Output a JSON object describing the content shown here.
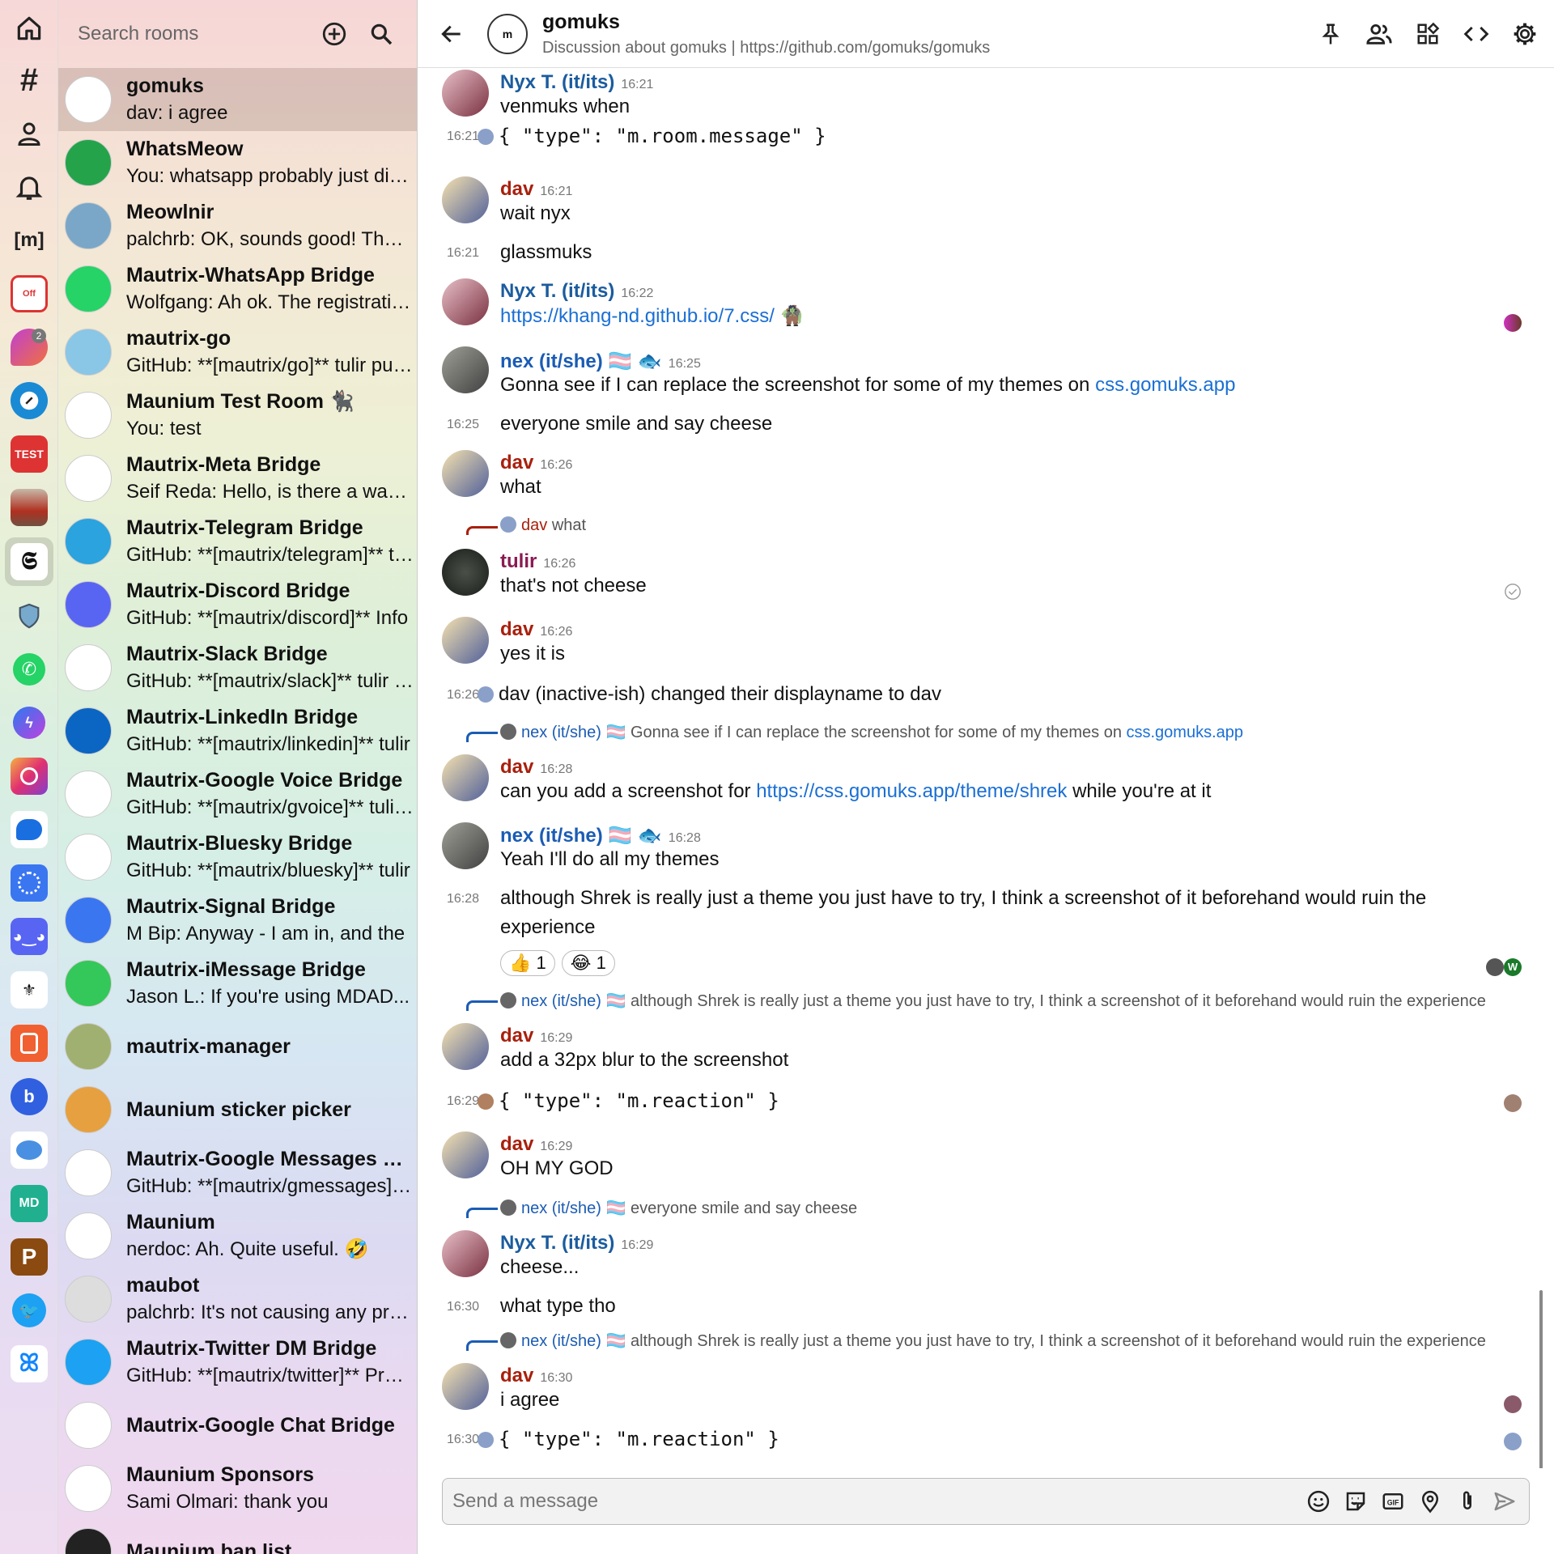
{
  "search": {
    "placeholder": "Search rooms"
  },
  "rooms": [
    {
      "name": "gomuks",
      "preview": "dav: i agree",
      "color": "#ffffff"
    },
    {
      "name": "WhatsMeow",
      "preview": "You: whatsapp probably just did a lot of manual testing",
      "color": "#25a34a"
    },
    {
      "name": "Meowlnir",
      "preview": "palchrb: OK, sounds good! Thanks for the help",
      "color": "#7aa7c7"
    },
    {
      "name": "Mautrix-WhatsApp Bridge",
      "preview": "Wolfgang: Ah ok. The registration file",
      "color": "#25d366"
    },
    {
      "name": "mautrix-go",
      "preview": "GitHub: **[mautrix/go]** tulir pushed",
      "color": "#8ac6e6"
    },
    {
      "name": "Maunium Test Room 🐈‍⬛",
      "preview": "You: test",
      "color": "#ffffff"
    },
    {
      "name": "Mautrix-Meta Bridge",
      "preview": "Seif Reda: Hello, is there a way to",
      "color": "#ffffff"
    },
    {
      "name": "Mautrix-Telegram Bridge",
      "preview": "GitHub: **[mautrix/telegram]** tulir",
      "color": "#2aa3de"
    },
    {
      "name": "Mautrix-Discord Bridge",
      "preview": "GitHub: **[mautrix/discord]** Info",
      "color": "#5865f2"
    },
    {
      "name": "Mautrix-Slack Bridge",
      "preview": "GitHub: **[mautrix/slack]** tulir pushed",
      "color": "#ffffff"
    },
    {
      "name": "Mautrix-LinkedIn Bridge",
      "preview": "GitHub: **[mautrix/linkedin]** tulir",
      "color": "#0a66c2"
    },
    {
      "name": "Mautrix-Google Voice Bridge",
      "preview": "GitHub: **[mautrix/gvoice]** tulir pushed",
      "color": "#ffffff"
    },
    {
      "name": "Mautrix-Bluesky Bridge",
      "preview": "GitHub: **[mautrix/bluesky]** tulir",
      "color": "#ffffff"
    },
    {
      "name": "Mautrix-Signal Bridge",
      "preview": "M Bip: Anyway - I am in, and the",
      "color": "#3a76f0"
    },
    {
      "name": "Mautrix-iMessage Bridge",
      "preview": "Jason L.: If you're using MDAD...",
      "color": "#34c759"
    },
    {
      "name": "mautrix-manager",
      "preview": "",
      "color": "#a0b070"
    },
    {
      "name": "Maunium sticker picker",
      "preview": "",
      "color": "#e6a040"
    },
    {
      "name": "Mautrix-Google Messages Bridge",
      "preview": "GitHub: **[mautrix/gmessages]** tulir",
      "color": "#ffffff"
    },
    {
      "name": "Maunium",
      "preview": "nerdoc: Ah. Quite useful. 🤣",
      "color": "#ffffff"
    },
    {
      "name": "maubot",
      "preview": "palchrb: It's not causing any problems",
      "color": "#dddddd"
    },
    {
      "name": "Mautrix-Twitter DM Bridge",
      "preview": "GitHub: **[mautrix/twitter]** Project",
      "color": "#1da1f2"
    },
    {
      "name": "Mautrix-Google Chat Bridge",
      "preview": "",
      "color": "#ffffff"
    },
    {
      "name": "Maunium Sponsors",
      "preview": "Sami Olmari: thank you",
      "color": "#ffffff"
    },
    {
      "name": "Maunium ban list",
      "preview": "",
      "color": "#222222"
    }
  ],
  "spaces": {
    "badge_count": "2",
    "letter_m": "[m]",
    "letter_p": "P",
    "test_label": "TEST",
    "md_label": "MD"
  },
  "header": {
    "room_name": "gomuks",
    "topic": "Discussion about gomuks | https://github.com/gomuks/gomuks"
  },
  "timeline": {
    "e1": {
      "sender": "Nyx T. (it/its)",
      "time": "16:21",
      "body": "venmuks when"
    },
    "e2": {
      "time": "16:21",
      "body": "{ \"type\": \"m.room.message\" }"
    },
    "e3": {
      "sender": "dav",
      "time": "16:21",
      "body": "wait nyx"
    },
    "e4": {
      "time": "16:21",
      "body": "glassmuks"
    },
    "e5": {
      "sender": "Nyx T. (it/its)",
      "time": "16:22",
      "link": "https://khang-nd.github.io/7.css/",
      "emoji": "🧌"
    },
    "e6": {
      "sender": "nex (it/she) 🏳️‍⚧️ 🐟",
      "time": "16:25",
      "body": "Gonna see if I can replace the screenshot for some of my themes on",
      "link": "css.gomuks.app"
    },
    "e7": {
      "time": "16:25",
      "body": "everyone smile and say cheese"
    },
    "e8": {
      "sender": "dav",
      "time": "16:26",
      "body": "what"
    },
    "r1": {
      "sender": "dav",
      "text": "what"
    },
    "e9": {
      "sender": "tulir",
      "time": "16:26",
      "body": "that's not cheese"
    },
    "e10": {
      "sender": "dav",
      "time": "16:26",
      "body": "yes it is"
    },
    "e11": {
      "time": "16:26",
      "body": "dav (inactive-ish) changed their displayname to dav"
    },
    "r2": {
      "sender": "nex (it/she) 🏳️‍⚧️",
      "text": "Gonna see if I can replace the screenshot for some of my themes on",
      "link": "css.gomuks.app"
    },
    "e12": {
      "sender": "dav",
      "time": "16:28",
      "body_a": "can you add a screenshot for",
      "link": "https://css.gomuks.app/theme/shrek",
      "body_b": "while you're at it"
    },
    "e13": {
      "sender": "nex (it/she) 🏳️‍⚧️ 🐟",
      "time": "16:28",
      "body": "Yeah I'll do all my themes"
    },
    "e14": {
      "time": "16:28",
      "body_a": "although Shrek is really just a theme you just have to try, I think a screenshot of it beforehand would ruin the",
      "body_b": "experience",
      "react1": "👍 1",
      "react2": "😂 1"
    },
    "r3": {
      "sender": "nex (it/she) 🏳️‍⚧️",
      "text": "although Shrek is really just a theme you just have to try, I think a screenshot of it beforehand would ruin the experience"
    },
    "e15": {
      "sender": "dav",
      "time": "16:29",
      "body": "add a 32px blur to the screenshot"
    },
    "e16": {
      "time": "16:29",
      "body": "{ \"type\": \"m.reaction\" }"
    },
    "e17": {
      "sender": "dav",
      "time": "16:29",
      "body": "OH MY GOD"
    },
    "r4": {
      "sender": "nex (it/she) 🏳️‍⚧️",
      "text": "everyone smile and say cheese"
    },
    "e18": {
      "sender": "Nyx T. (it/its)",
      "time": "16:29",
      "body": "cheese..."
    },
    "e19": {
      "time": "16:30",
      "body": "what type tho"
    },
    "r5": {
      "sender": "nex (it/she) 🏳️‍⚧️",
      "text": "although Shrek is really just a theme you just have to try, I think a screenshot of it beforehand would ruin the experience"
    },
    "e20": {
      "sender": "dav",
      "time": "16:30",
      "body": "i agree"
    },
    "e21": {
      "time": "16:30",
      "body": "{ \"type\": \"m.reaction\" }"
    }
  },
  "composer": {
    "placeholder": "Send a message"
  },
  "colors": {
    "dav": "#a8200d",
    "nyx": "#1b5c9e",
    "nex": "#1b5cb4",
    "tulir": "#8a1b52",
    "link": "#1a6fd4"
  }
}
